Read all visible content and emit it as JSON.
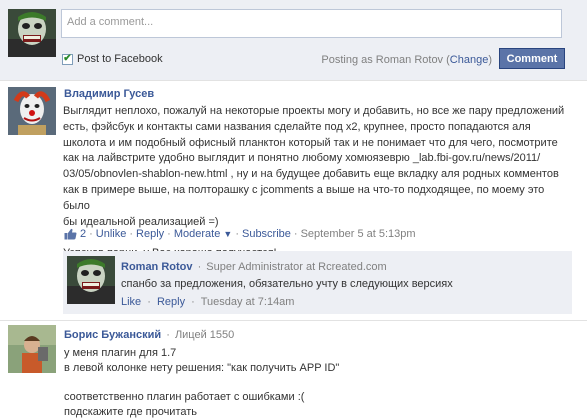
{
  "composer": {
    "placeholder": "Add a comment...",
    "post_to_facebook": "Post to Facebook",
    "posting_as": "Posting as Roman Rotov (",
    "change": "Change",
    "posting_close": ")",
    "comment_button": "Comment"
  },
  "comments": [
    {
      "author": "Владимир Гусев",
      "text_lines": [
        "Выглядит неплохо, пожалуй на некоторые проекты могу и добавить, но все же пару предложений",
        "есть, фэйсбук и контакты сами названия сделайте под x2, крупнее, просто попадаются аля",
        "школота и им подобный офисный планктон который так и не понимает что для чего, посмотрите",
        "как на лайвстрите удобно выглядит и понятно любому хомюязеврю _lab.fbi-gov.ru/news/2011/",
        "03/05/obnovlen-shablon-new.html , ну и на будущее добавить еще вкладку аля родных комментов",
        "как в примере выше, на полторашку с jcomments а выше на что-то подходящее, по моему это было",
        "бы идеальной реализацией =)",
        "",
        "Успехов парни, у Вас хорошо получается!"
      ],
      "like_count": "2",
      "actions": [
        "Unlike",
        "Reply",
        "Moderate"
      ],
      "subscribe": "Subscribe",
      "timestamp": "September 5 at 5:13pm"
    },
    {
      "author": "Roman Rotov",
      "meta": "Super Administrator at Rcreated.com",
      "text_lines": [
        "спанбо за предложения, обязательно учту в следующих версиях"
      ],
      "actions": [
        "Like",
        "Reply"
      ],
      "timestamp": "Tuesday at 7:14am"
    },
    {
      "author": "Борис Бужанский",
      "meta": "Лицей 1550",
      "text_lines": [
        "у меня плагин для 1.7",
        "в левой колонке нету решения: \"как получить APP ID\"",
        "",
        "соответственно плагин работает с ошибками :(",
        "подскажите где прочитать"
      ]
    }
  ],
  "colors": {
    "link": "#3b5998",
    "button": "#5b74a8",
    "composer_bg": "#edeff4"
  }
}
